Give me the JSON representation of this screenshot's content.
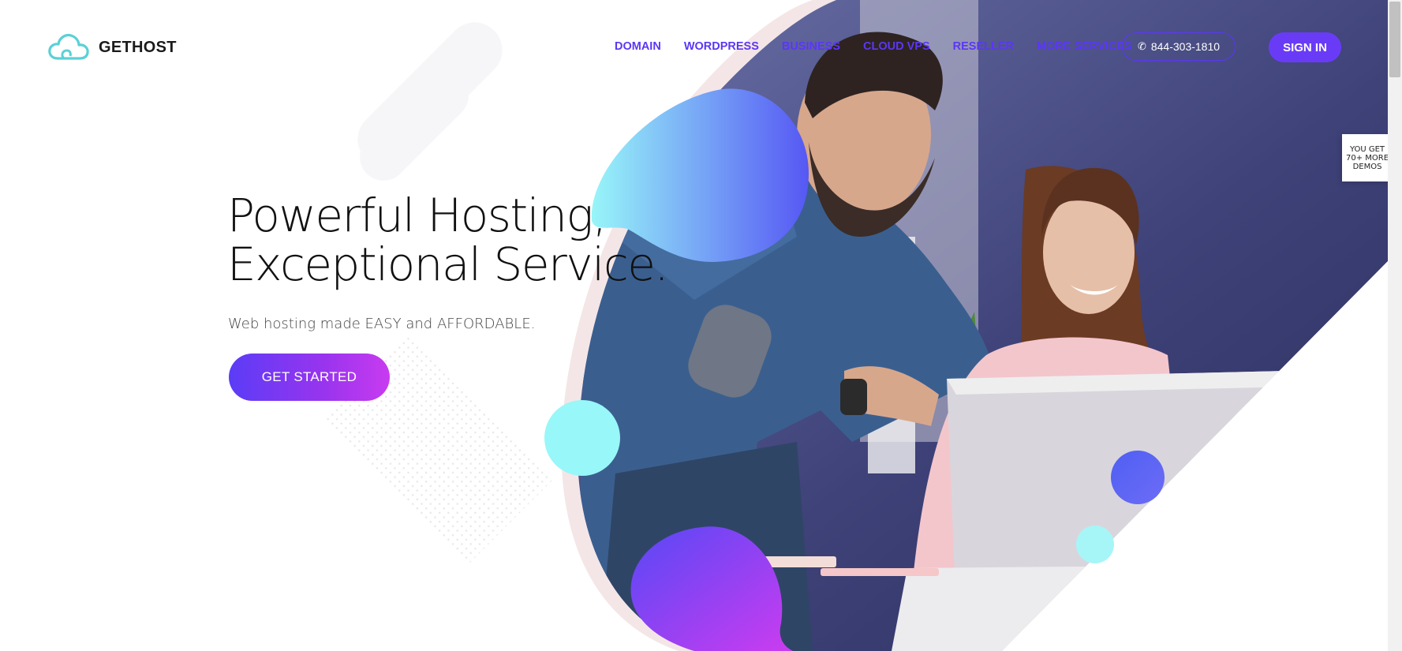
{
  "brand": {
    "name": "GETHOST",
    "logo_icon": "cloud-icon",
    "accent": "#5b37f5"
  },
  "nav": {
    "items": [
      "DOMAIN",
      "WORDPRESS",
      "BUSINESS",
      "CLOUD VPS",
      "RESELLER",
      "MORE SERVICES"
    ]
  },
  "header": {
    "phone": "844-303-1810",
    "phone_icon": "phone-icon",
    "signin_label": "SIGN IN"
  },
  "hero": {
    "title_line1": "Powerful Hosting,",
    "title_line2": "Exceptional Service.",
    "subtitle": "Web hosting made EASY and AFFORDABLE.",
    "cta_label": "GET STARTED"
  },
  "demos_tab": {
    "label": "YOU GET 70+ MORE DEMOS"
  },
  "colors": {
    "cyan": "#9af8f6",
    "violet": "#5b4cf5",
    "magenta": "#c93cf0"
  }
}
